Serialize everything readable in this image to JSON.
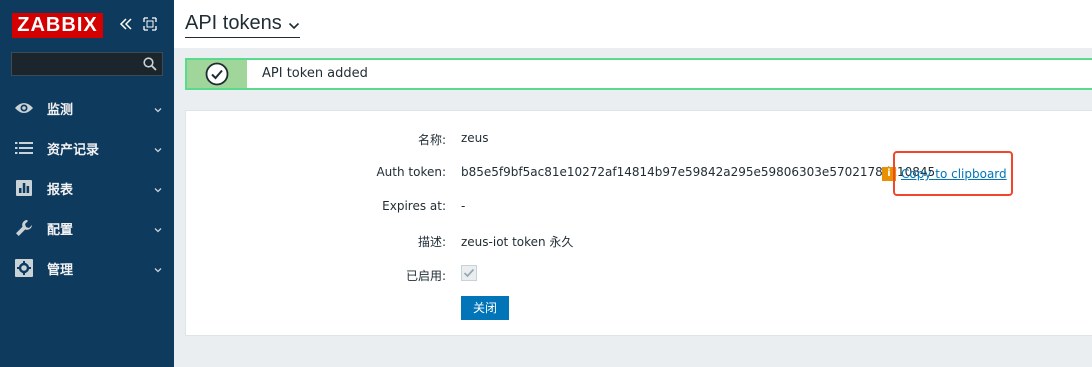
{
  "brand": {
    "logo_text": "ZABBIX",
    "colors": {
      "sidebar": "#0e3a5e",
      "logo": "#d40000",
      "accent": "#0275b8",
      "success": "#59db8f",
      "highlight": "#f0472b"
    }
  },
  "sidebar": {
    "collapse_icon": "double-chevron-left-icon",
    "kiosk_icon": "kiosk-mode-icon",
    "search": {
      "value": "",
      "placeholder": "",
      "icon": "search-icon"
    },
    "items": [
      {
        "label": "监测",
        "icon": "eye-icon"
      },
      {
        "label": "资产记录",
        "icon": "list-icon"
      },
      {
        "label": "报表",
        "icon": "bar-chart-icon"
      },
      {
        "label": "配置",
        "icon": "wrench-icon"
      },
      {
        "label": "管理",
        "icon": "gear-icon"
      }
    ]
  },
  "header": {
    "title": "API tokens"
  },
  "message": {
    "text": "API token added",
    "icon": "check-circle-icon"
  },
  "form": {
    "name": {
      "label": "名称:",
      "value": "zeus"
    },
    "auth_token": {
      "label": "Auth token:",
      "value": "b85e5f9bf5ac81e10272af14814b97e59842a295e59806303e5702178dc10845",
      "info_icon": "i",
      "copy_label": "Copy to clipboard"
    },
    "expires": {
      "label": "Expires at:",
      "value": "-"
    },
    "description": {
      "label": "描述:",
      "value": "zeus-iot token 永久"
    },
    "enabled": {
      "label": "已启用:",
      "checked": true
    },
    "close_label": "关闭"
  }
}
